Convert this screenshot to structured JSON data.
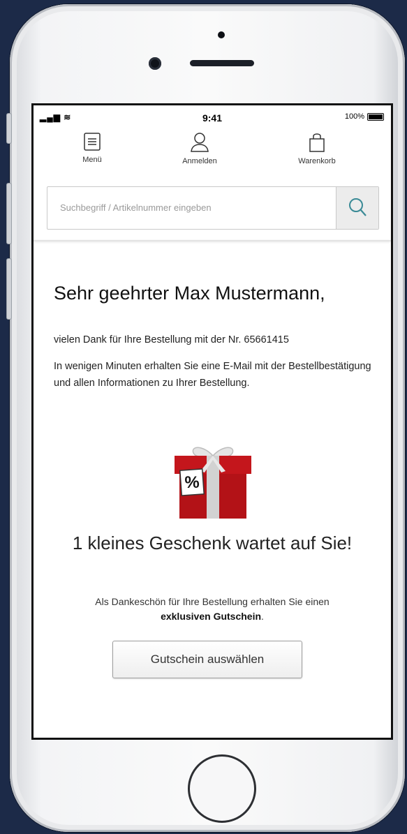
{
  "status_bar": {
    "time": "9:41",
    "battery": "100%"
  },
  "nav": {
    "menu": "Menü",
    "login": "Anmelden",
    "cart": "Warenkorb"
  },
  "search": {
    "placeholder": "Suchbegriff / Artikelnummer eingeben"
  },
  "greeting": "Sehr geehrter Max Mustermann,",
  "order_text": "vielen Dank für Ihre Bestellung mit der Nr. 65661415",
  "email_text": "In wenigen Minuten erhalten Sie eine E-Mail mit der Bestellbestätigung und allen Informationen zu Ihrer Bestellung.",
  "gift": {
    "tag": "%",
    "headline": "1 kleines Geschenk wartet auf Sie!",
    "text_prefix": "Als Dankeschön für Ihre Bestellung erhalten Sie einen",
    "text_bold": "exklusiven Gutschein",
    "text_suffix": ".",
    "button": "Gutschein auswählen"
  },
  "colors": {
    "background": "#1c2a48",
    "gift_red": "#c4161c",
    "search_icon": "#3a8a96"
  }
}
